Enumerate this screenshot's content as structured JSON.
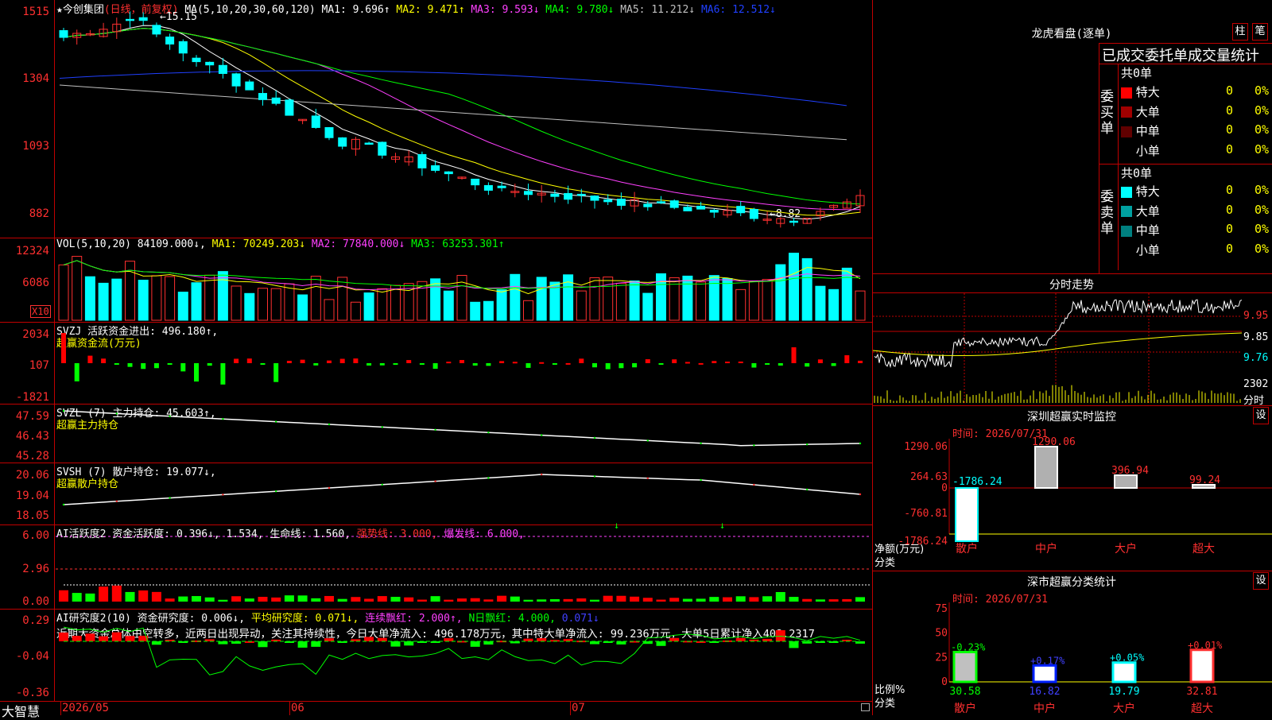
{
  "app": {
    "brand": "大智慧"
  },
  "kline": {
    "title": "★今创集团",
    "mode": "(日线，前复权)",
    "ma_formula": "MA(5,10,20,30,60,120)",
    "ma": [
      {
        "label": "MA1: 9.696↑",
        "color": "#ffffff"
      },
      {
        "label": "MA2: 9.471↑",
        "color": "#ffff00"
      },
      {
        "label": "MA3: 9.593↓",
        "color": "#ff40ff"
      },
      {
        "label": "MA4: 9.780↓",
        "color": "#00ff00"
      },
      {
        "label": "MA5: 11.212↓",
        "color": "#c0c0c0"
      },
      {
        "label": "MA6: 12.512↓",
        "color": "#2040ff"
      }
    ],
    "y_ticks": [
      "1515",
      "1304",
      "1093",
      "882"
    ],
    "high_label": "15.15",
    "low_label": "8.82"
  },
  "vol": {
    "title": "VOL(5,10,20)",
    "value": "84109.000↓,",
    "ma": [
      {
        "label": "MA1: 70249.203↓",
        "color": "#ffff00"
      },
      {
        "label": "MA2: 77840.000↓",
        "color": "#ff40ff"
      },
      {
        "label": "MA3: 63253.301↑",
        "color": "#00ff00"
      }
    ],
    "y_ticks": [
      "12324",
      "6086"
    ],
    "unit": "X10"
  },
  "svzj": {
    "title": "SVZJ  活跃资金进出: 496.180↑,",
    "sub": "超赢资金流(万元)",
    "y_ticks": [
      "2034",
      "107",
      "-1821"
    ]
  },
  "svzl": {
    "title": "SVZL (7) 主力持仓: 45.603↑,",
    "sub": "超赢主力持仓",
    "y_ticks": [
      "47.59",
      "46.43",
      "45.28"
    ]
  },
  "svsh": {
    "title": "SVSH (7) 散户持仓: 19.077↓,",
    "sub": "超赢散户持仓",
    "y_ticks": [
      "20.06",
      "19.04",
      "18.05"
    ]
  },
  "ai1": {
    "title": "AI活跃度2 资金活跃度: 0.396↓, 1.534, 生命线: 1.560,",
    "strong": "强势线: 3.000,",
    "burst": "爆发线: 6.000,",
    "y_ticks": [
      "6.00",
      "2.96",
      "0.00"
    ]
  },
  "ai2": {
    "title": "AI研究度2(10) 资金研究度: 0.006↓,",
    "avg": "平均研究度: 0.071↓,",
    "cont": "连续飘红: 2.000↑,",
    "nday": "N日飘红: 4.000,",
    "last": "0.071↓",
    "comment": "近期大资金总体由空转多，近两日出现异动，关注其持续性，今日大单净流入: 496.178万元，其中特大单净流入: 99.236万元，大单5日累计净入408.2317",
    "y_ticks": [
      "0.29",
      "-0.04",
      "-0.36"
    ]
  },
  "x_dates": [
    "2026/05",
    "06",
    "07"
  ],
  "dragon": {
    "title": "龙虎看盘(逐单)",
    "btn_bar": "柱",
    "btn_pen": "笔",
    "subtitle": "已成交委托单成交量统计",
    "buy_label": "委买单",
    "sell_label": "委卖单",
    "buy_total": "共0单",
    "sell_total": "共0单",
    "buy_rows": [
      {
        "name": "特大",
        "count": "0",
        "pct": "0%",
        "color": "#ff0000"
      },
      {
        "name": "大单",
        "count": "0",
        "pct": "0%",
        "color": "#a00000"
      },
      {
        "name": "中单",
        "count": "0",
        "pct": "0%",
        "color": "#600000"
      },
      {
        "name": "小单",
        "count": "0",
        "pct": "0%",
        "color": "#000000"
      }
    ],
    "sell_rows": [
      {
        "name": "特大",
        "count": "0",
        "pct": "0%",
        "color": "#00ffff"
      },
      {
        "name": "大单",
        "count": "0",
        "pct": "0%",
        "color": "#00a0a0"
      },
      {
        "name": "中单",
        "count": "0",
        "pct": "0%",
        "color": "#008080"
      },
      {
        "name": "小单",
        "count": "0",
        "pct": "0%",
        "color": "#000000"
      }
    ]
  },
  "intraday": {
    "title": "分时走势",
    "y_ticks": [
      "9.95",
      "9.85",
      "9.76"
    ],
    "vol_tick": "2302",
    "unit": "分时"
  },
  "sz_monitor": {
    "title": "深圳超赢实时监控",
    "btn": "设",
    "time": "时间: 2026/07/31",
    "y_ticks": [
      "1290.06",
      "264.63",
      "0",
      "-760.81",
      "-1786.24"
    ],
    "y_unit": "净额(万元)",
    "x_label": "分类",
    "chart_data": {
      "type": "bar",
      "categories": [
        "散户",
        "中户",
        "大户",
        "超大"
      ],
      "values": [
        -1786.24,
        1290.06,
        396.94,
        99.24
      ],
      "value_labels": [
        "-1786.24",
        "1290.06",
        "396.94",
        "99.24"
      ],
      "ylim": [
        -1786.24,
        1290.06
      ]
    }
  },
  "sz_class": {
    "title": "深市超赢分类统计",
    "btn": "设",
    "time": "时间: 2026/07/31",
    "y_ticks": [
      "75",
      "50",
      "25",
      "0"
    ],
    "y_unit": "比例%",
    "x_label": "分类",
    "chart_data": {
      "type": "bar",
      "categories": [
        "散户",
        "中户",
        "大户",
        "超大"
      ],
      "values": [
        30.58,
        16.82,
        19.79,
        32.81
      ],
      "changes": [
        "-0.23%",
        "+0.17%",
        "+0.05%",
        "+0.01%"
      ],
      "ylim": [
        0,
        75
      ]
    }
  }
}
